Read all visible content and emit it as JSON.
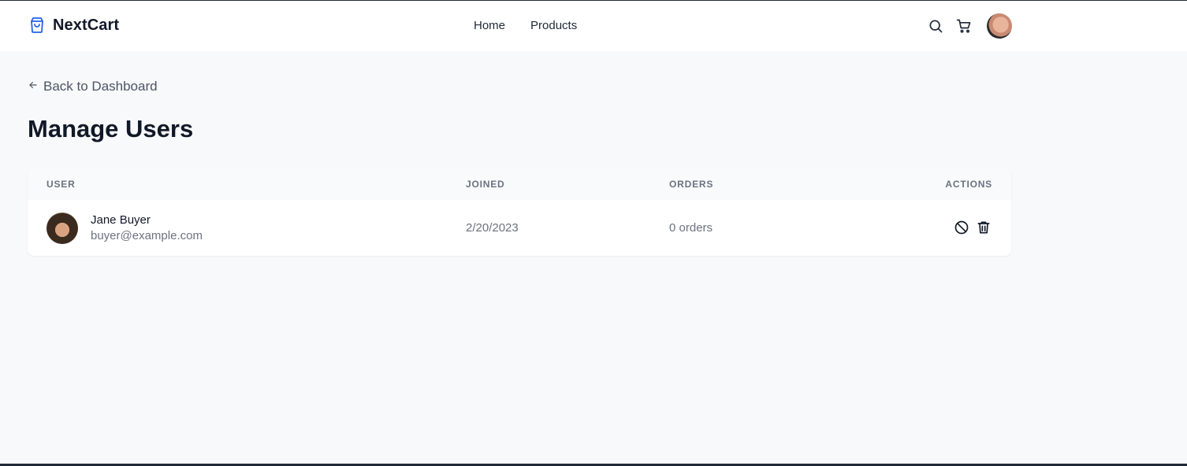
{
  "brand": {
    "name": "NextCart",
    "accent_color": "#2563eb",
    "icon": "shopping-bag-icon"
  },
  "nav": {
    "items": [
      {
        "label": "Home"
      },
      {
        "label": "Products"
      }
    ]
  },
  "top_icons": {
    "search": "search-icon",
    "cart": "cart-icon",
    "avatar": "user-avatar"
  },
  "back_link": {
    "label": "Back to Dashboard",
    "icon": "arrow-left-icon"
  },
  "page": {
    "title": "Manage Users"
  },
  "table": {
    "headers": {
      "user": "USER",
      "joined": "JOINED",
      "orders": "ORDERS",
      "actions": "ACTIONS"
    },
    "rows": [
      {
        "name": "Jane Buyer",
        "email": "buyer@example.com",
        "joined": "2/20/2023",
        "orders": "0 orders",
        "actions": [
          "ban-icon",
          "trash-icon"
        ]
      }
    ]
  }
}
